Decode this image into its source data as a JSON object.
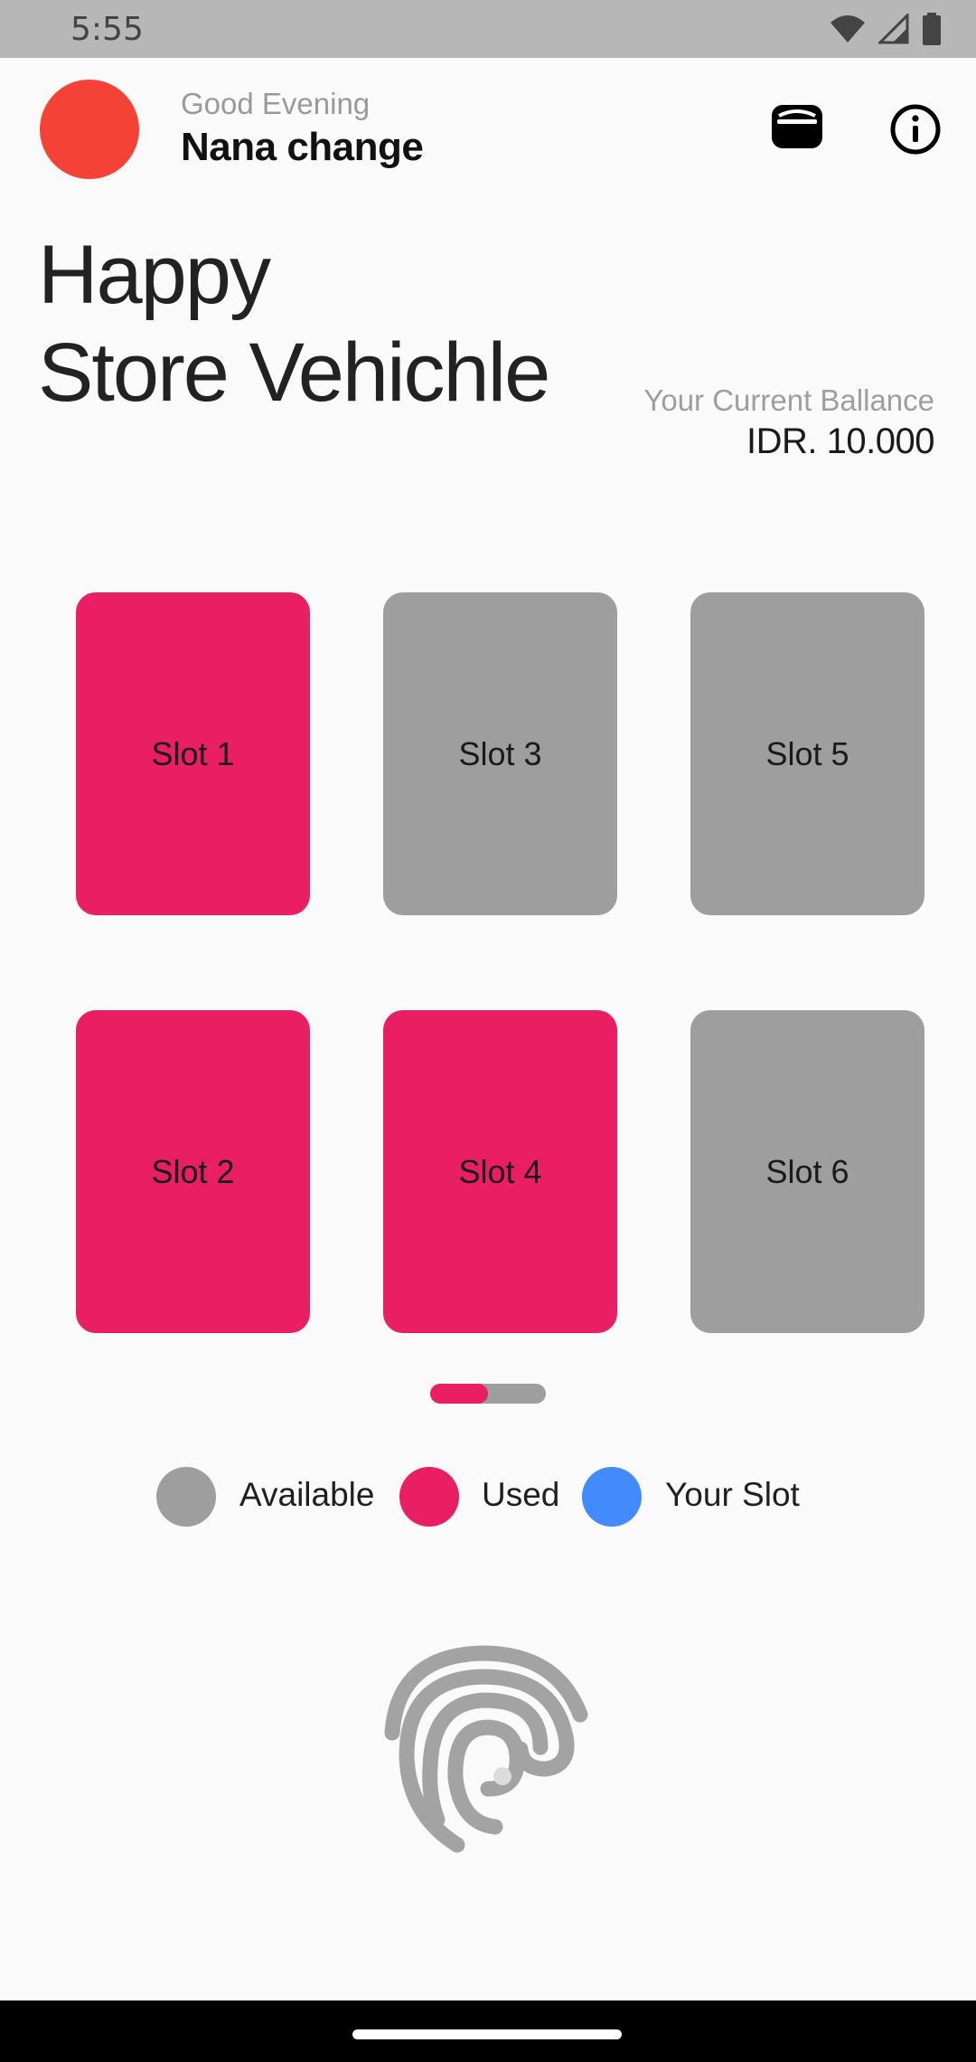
{
  "status_bar": {
    "time": "5:55",
    "icons": [
      "wifi-icon",
      "signal-icon",
      "battery-icon"
    ]
  },
  "header": {
    "greeting": "Good Evening",
    "user_name": "Nana change",
    "avatar_color": "#f44336",
    "actions": [
      "wallet-icon",
      "info-icon"
    ]
  },
  "title": {
    "line1": "Happy",
    "line2": "Store Vehichle"
  },
  "balance": {
    "label": "Your Current Ballance",
    "value": "IDR. 10.000"
  },
  "slots": [
    {
      "label": "Slot 1",
      "status": "used"
    },
    {
      "label": "Slot 2",
      "status": "used"
    },
    {
      "label": "Slot 3",
      "status": "available"
    },
    {
      "label": "Slot 4",
      "status": "used"
    },
    {
      "label": "Slot 5",
      "status": "available"
    },
    {
      "label": "Slot 6",
      "status": "available"
    }
  ],
  "page_indicator": {
    "current_page": 1,
    "total_pages": 2
  },
  "legend": [
    {
      "label": "Available",
      "color": "#9e9e9e"
    },
    {
      "label": "Used",
      "color": "#e91e63"
    },
    {
      "label": "Your Slot",
      "color": "#448aff"
    }
  ],
  "fingerprint": {
    "icon": "fingerprint-icon"
  },
  "colors": {
    "used": "#e91e63",
    "available": "#9e9e9e",
    "your_slot": "#448aff",
    "background": "#fafafa"
  }
}
